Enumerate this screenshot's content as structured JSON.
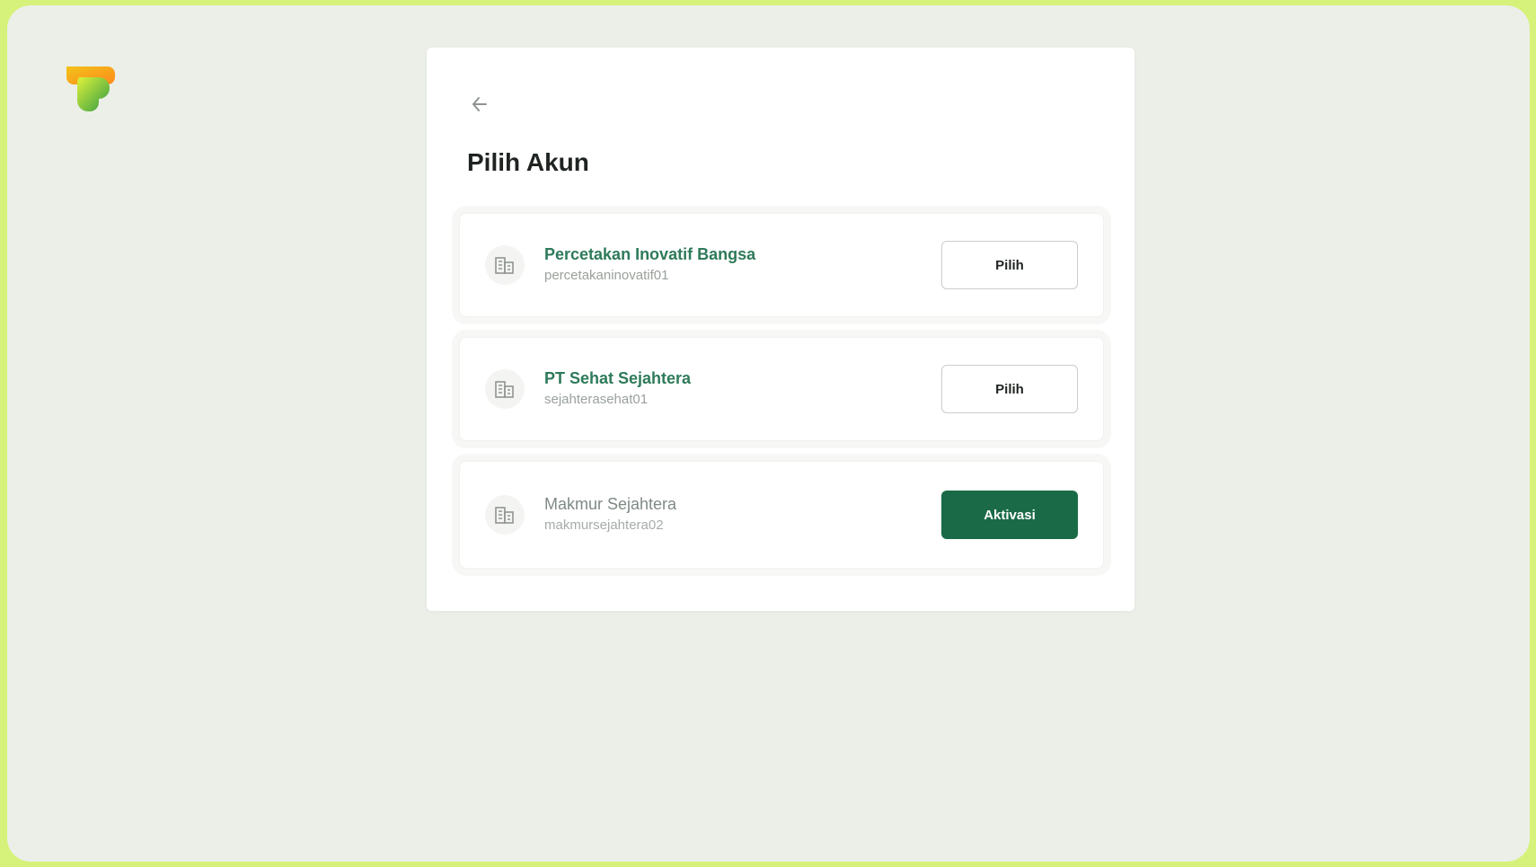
{
  "brand": {
    "logo_icon": "brand-logo-icon"
  },
  "page": {
    "back_icon": "arrow-left-icon",
    "title": "Pilih Akun"
  },
  "accounts": [
    {
      "name": "Percetakan Inovatif Bangsa",
      "username": "percetakaninovatif01",
      "icon": "building-icon",
      "action_label": "Pilih",
      "action_type": "select"
    },
    {
      "name": "PT Sehat Sejahtera",
      "username": "sejahterasehat01",
      "icon": "building-icon",
      "action_label": "Pilih",
      "action_type": "select"
    },
    {
      "name": "Makmur Sejahtera",
      "username": "makmursejahtera02",
      "icon": "building-icon",
      "action_label": "Aktivasi",
      "action_type": "activate"
    }
  ],
  "colors": {
    "page_border": "#d6f27a",
    "background": "#ebefe8",
    "panel": "#ffffff",
    "account_name": "#2e7a5a",
    "primary_button": "#1a6a47"
  }
}
